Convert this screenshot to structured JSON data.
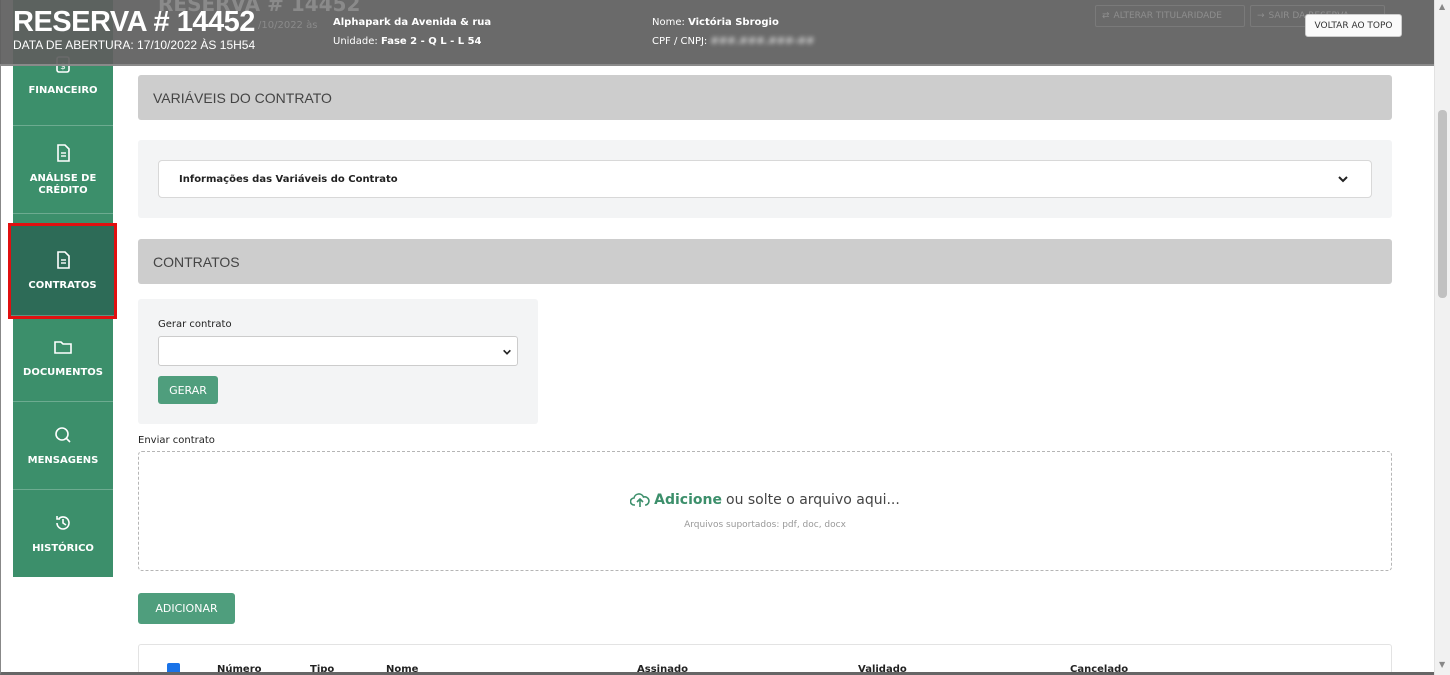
{
  "header": {
    "title": "RESERVA # 14452",
    "ghost_title": "RESERVA # 14452",
    "opened": "DATA DE ABERTURA: 17/10/2022 ÀS 15H54",
    "ghost_date": "/10/2022 às",
    "project": "Alphapark da Avenida & rua",
    "unit_label": "Unidade:",
    "unit_value": "Fase 2 - Q L - L 54",
    "name_label": "Nome:",
    "name_value": "Victória Sbrogio",
    "doc_label": "CPF / CNPJ:",
    "doc_value": "###.###.###-##",
    "change_owner": "ALTERAR TITULARIDADE",
    "leave": "SAIR DA RESERVA",
    "back_top": "VOLTAR AO TOPO"
  },
  "sidebar": {
    "items": [
      {
        "label": "FINANCEIRO",
        "icon": "money-doc-icon"
      },
      {
        "label": "ANÁLISE DE CRÉDITO",
        "icon": "document-icon"
      },
      {
        "label": "CONTRATOS",
        "icon": "document-icon"
      },
      {
        "label": "DOCUMENTOS",
        "icon": "folder-icon"
      },
      {
        "label": "MENSAGENS",
        "icon": "chat-icon"
      },
      {
        "label": "HISTÓRICO",
        "icon": "history-icon"
      }
    ]
  },
  "variables": {
    "header": "VARIÁVEIS DO CONTRATO",
    "accordion": "Informações das Variáveis do Contrato"
  },
  "contracts": {
    "header": "CONTRATOS",
    "generate_label": "Gerar contrato",
    "generate_button": "GERAR",
    "send_label": "Enviar contrato",
    "drop_add": "Adicione",
    "drop_text": "ou solte o arquivo aqui...",
    "drop_sub": "Arquivos suportados: pdf, doc, docx",
    "add_button": "ADICIONAR",
    "columns": [
      "Número",
      "Tipo",
      "Nome",
      "Assinado",
      "Validado",
      "Cancelado"
    ]
  },
  "colors": {
    "brand_green": "#3c8f6b",
    "active_outline": "#e01010"
  }
}
